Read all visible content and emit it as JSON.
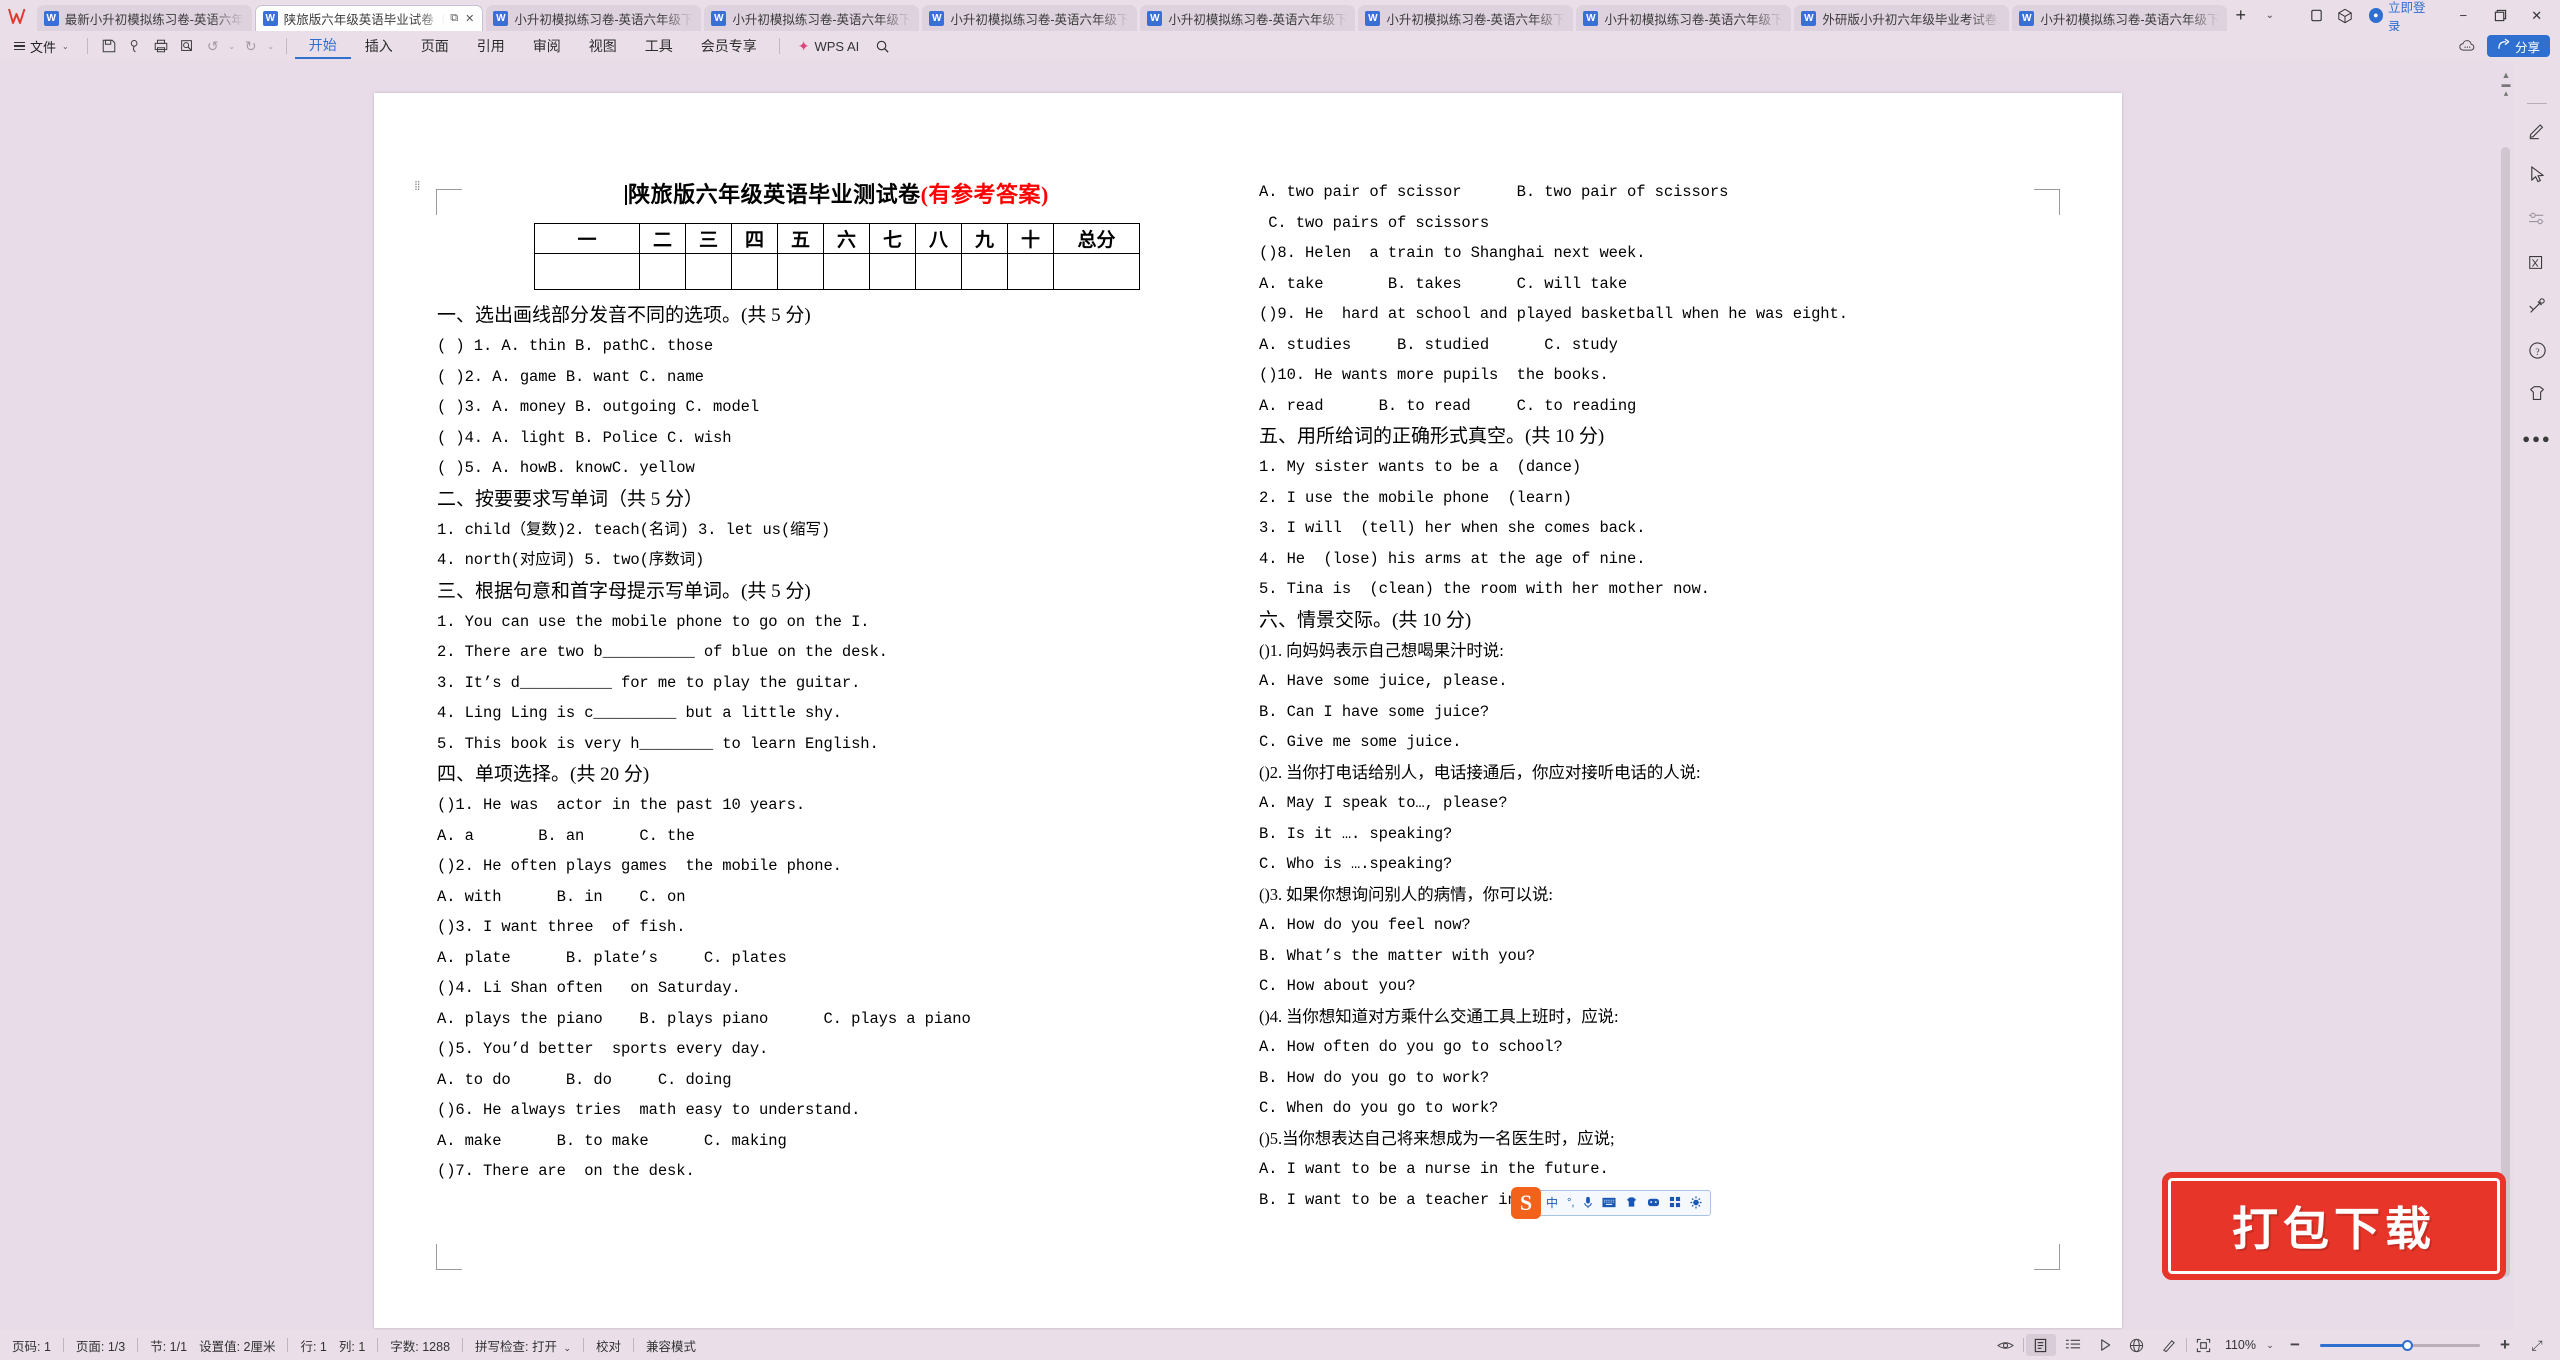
{
  "window": {
    "app_logo": "W",
    "tabs": [
      {
        "label": "最新小升初模拟练习卷-英语六年级下",
        "active": false
      },
      {
        "label": "陕旅版六年级英语毕业试卷（",
        "active": true
      },
      {
        "label": "小升初模拟练习卷-英语六年级下册",
        "active": false
      },
      {
        "label": "小升初模拟练习卷-英语六年级下册",
        "active": false
      },
      {
        "label": "小升初模拟练习卷-英语六年级下册人",
        "active": false
      },
      {
        "label": "小升初模拟练习卷-英语六年级下册人",
        "active": false
      },
      {
        "label": "小升初模拟练习卷-英语六年级下册外",
        "active": false
      },
      {
        "label": "小升初模拟练习卷-英语六年级下册人",
        "active": false
      },
      {
        "label": "外研版小升初六年级毕业考试卷.doc",
        "active": false
      },
      {
        "label": "小升初模拟练习卷-英语六年级下册沪",
        "active": false
      }
    ],
    "new_tab": "+",
    "tab_dropdown": "⌄",
    "restore_icon": "⧉",
    "cube_icon": "⬡",
    "login_label": "立即登录",
    "minimize": "−",
    "maximize": "⧉",
    "close": "✕",
    "active_tab_restore": "⧉",
    "active_tab_close": "✕"
  },
  "ribbon": {
    "file_label": "文件",
    "file_caret": "⌄",
    "quick_icons": [
      "save-icon",
      "search-doc-icon",
      "print-icon",
      "print-preview-icon"
    ],
    "undo": "↺",
    "redo": "↻",
    "more_caret": "⌄",
    "tabs": [
      {
        "label": "开始",
        "active": true
      },
      {
        "label": "插入",
        "active": false
      },
      {
        "label": "页面",
        "active": false
      },
      {
        "label": "引用",
        "active": false
      },
      {
        "label": "审阅",
        "active": false
      },
      {
        "label": "视图",
        "active": false
      },
      {
        "label": "工具",
        "active": false
      },
      {
        "label": "会员专享",
        "active": false
      }
    ],
    "wps_ai": "WPS AI",
    "search_icon": "search-icon",
    "share_label": "分享",
    "cloud_icon": "cloud-icon"
  },
  "document": {
    "title_main": "陕旅版六年级英语毕业测试卷",
    "title_red": "(有参考答案)",
    "score_table": {
      "headers": [
        "一",
        "二",
        "三",
        "四",
        "五",
        "六",
        "七",
        "八",
        "九",
        "十",
        "总分"
      ],
      "values": [
        "",
        "",
        "",
        "",
        "",
        "",
        "",
        "",
        "",
        "",
        ""
      ]
    },
    "left_column": [
      {
        "type": "head",
        "text": "一、选出画线部分发音不同的选项。(共 5 分)"
      },
      {
        "type": "q",
        "text": "( ) 1. A. thin B. pathC. those"
      },
      {
        "type": "q",
        "text": "( )2. A. game B. want C. name"
      },
      {
        "type": "q",
        "text": "( )3. A. money B. outgoing C. model"
      },
      {
        "type": "q",
        "text": "( )4. A. light B. Police C. wish"
      },
      {
        "type": "q",
        "text": "( )5. A. howB. knowC. yellow"
      },
      {
        "type": "head",
        "text": "二、按要要求写单词（共 5 分）"
      },
      {
        "type": "q",
        "text": "1. child（复数)2. teach(名词) 3. let us(缩写)"
      },
      {
        "type": "q",
        "text": "4. north(对应词) 5. two(序数词)"
      },
      {
        "type": "head",
        "text": "三、根据句意和首字母提示写单词。(共 5 分)"
      },
      {
        "type": "q",
        "text": "1. You can use the mobile phone to go on the I."
      },
      {
        "type": "q",
        "text": "2. There are two b__________ of blue on the desk."
      },
      {
        "type": "q",
        "text": "3. It’s d__________ for me to play the guitar."
      },
      {
        "type": "q",
        "text": "4. Ling Ling is c_________ but a little shy."
      },
      {
        "type": "q",
        "text": "5. This book is very h________ to learn English."
      },
      {
        "type": "head",
        "text": "四、单项选择。(共 20 分)"
      },
      {
        "type": "q",
        "text": "()1. He was  actor in the past 10 years."
      },
      {
        "type": "q",
        "text": "A. a       B. an      C. the"
      },
      {
        "type": "q",
        "text": "()2. He often plays games  the mobile phone."
      },
      {
        "type": "q",
        "text": "A. with      B. in    C. on"
      },
      {
        "type": "q",
        "text": "()3. I want three  of fish."
      },
      {
        "type": "q",
        "text": "A. plate      B. plate’s     C. plates"
      },
      {
        "type": "q",
        "text": "()4. Li Shan often   on Saturday."
      },
      {
        "type": "q",
        "text": "A. plays the piano    B. plays piano      C. plays a piano"
      },
      {
        "type": "q",
        "text": "()5. You’d better  sports every day."
      },
      {
        "type": "q",
        "text": "A. to do      B. do     C. doing"
      },
      {
        "type": "q",
        "text": "()6. He always tries  math easy to understand."
      },
      {
        "type": "q",
        "text": "A. make      B. to make      C. making"
      },
      {
        "type": "q",
        "text": "()7. There are  on the desk."
      }
    ],
    "right_column": [
      {
        "type": "q",
        "text": "A. two pair of scissor      B. two pair of scissors"
      },
      {
        "type": "q",
        "text": " C. two pairs of scissors"
      },
      {
        "type": "q",
        "text": "()8. Helen  a train to Shanghai next week."
      },
      {
        "type": "q",
        "text": "A. take       B. takes      C. will take"
      },
      {
        "type": "q",
        "text": "()9. He  hard at school and played basketball when he was eight."
      },
      {
        "type": "q",
        "text": "A. studies     B. studied      C. study"
      },
      {
        "type": "q",
        "text": "()10. He wants more pupils  the books."
      },
      {
        "type": "q",
        "text": "A. read      B. to read     C. to reading"
      },
      {
        "type": "head",
        "text": "五、用所给词的正确形式真空。(共 10 分)"
      },
      {
        "type": "q",
        "text": "1. My sister wants to be a  (dance)"
      },
      {
        "type": "q",
        "text": "2. I use the mobile phone  (learn)"
      },
      {
        "type": "q",
        "text": "3. I will  (tell) her when she comes back."
      },
      {
        "type": "q",
        "text": "4. He  (lose) his arms at the age of nine."
      },
      {
        "type": "q",
        "text": "5. Tina is  (clean) the room with her mother now."
      },
      {
        "type": "head",
        "text": "六、情景交际。(共 10 分)"
      },
      {
        "type": "cn",
        "text": "()1. 向妈妈表示自己想喝果汁时说:"
      },
      {
        "type": "q",
        "text": "A. Have some juice, please."
      },
      {
        "type": "q",
        "text": "B. Can I have some juice?"
      },
      {
        "type": "q",
        "text": "C. Give me some juice."
      },
      {
        "type": "cn",
        "text": "()2. 当你打电话给别人，电话接通后，你应对接听电话的人说:"
      },
      {
        "type": "q",
        "text": "A. May I speak to…, please?"
      },
      {
        "type": "q",
        "text": "B. Is it …. speaking?"
      },
      {
        "type": "q",
        "text": "C. Who is ….speaking?"
      },
      {
        "type": "cn",
        "text": "()3. 如果你想询问别人的病情，你可以说:"
      },
      {
        "type": "q",
        "text": "A. How do you feel now?"
      },
      {
        "type": "q",
        "text": "B. What’s the matter with you?"
      },
      {
        "type": "q",
        "text": "C. How about you?"
      },
      {
        "type": "cn",
        "text": "()4. 当你想知道对方乘什么交通工具上班时，应说:"
      },
      {
        "type": "q",
        "text": "A. How often do you go to school?"
      },
      {
        "type": "q",
        "text": "B. How do you go to work?"
      },
      {
        "type": "q",
        "text": "C. When do you go to work?"
      },
      {
        "type": "cn",
        "text": "()5.当你想表达自己将来想成为一名医生时，应说;"
      },
      {
        "type": "q",
        "text": "A. I want to be a nurse in the future."
      },
      {
        "type": "q",
        "text": "B. I want to be a teacher in t"
      }
    ]
  },
  "right_sidebar": {
    "icons": [
      "minus-icon",
      "pen-icon",
      "cursor-icon",
      "sliders-icon",
      "stamp-icon",
      "tools-icon",
      "help-icon",
      "shirt-icon",
      "more-icon"
    ]
  },
  "status_bar": {
    "page_number": "页码: 1",
    "page_count": "页面: 1/3",
    "section": "节: 1/1",
    "setting": "设置值: 2厘米",
    "row": "行: 1",
    "column": "列: 1",
    "word_count": "字数: 1288",
    "spellcheck": "拼写检查: 打开",
    "spellcheck_caret": "⌄",
    "proofread": "校对",
    "compat_mode": "兼容模式",
    "view_icons": [
      "eye-icon",
      "page-view-icon",
      "outline-view-icon",
      "play-icon",
      "web-view-icon",
      "brush-icon",
      "focus-icon"
    ],
    "zoom_level": "110%",
    "zoom_caret": "⌄",
    "zoom_out": "−",
    "zoom_in": "+",
    "fullscreen": "⤢"
  },
  "ime_toolbar": {
    "logo": "S",
    "icons": [
      "chinese-mode-icon",
      "punctuation-icon",
      "microphone-icon",
      "keyboard-icon",
      "skin-icon",
      "emoji-icon",
      "apps-icon",
      "settings-icon"
    ],
    "labels": [
      "中",
      "°,",
      "🎤",
      "▦",
      "👕",
      "☻",
      "▦",
      "✿"
    ]
  },
  "download_watermark": {
    "label": "打包下载"
  },
  "colors": {
    "accent": "#2f6fd0",
    "chrome": "#eadfe9",
    "workspace": "#e8dce8",
    "title_red": "#ff0000",
    "watermark_red": "#e8352a",
    "ime_orange": "#f3621b"
  }
}
